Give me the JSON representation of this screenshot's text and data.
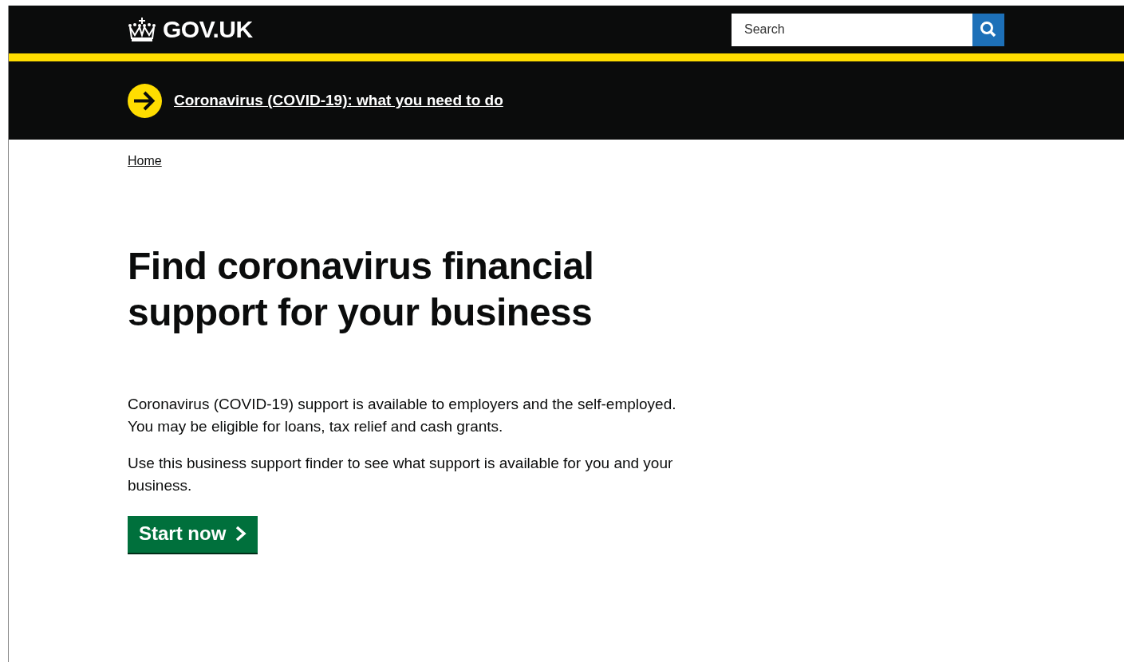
{
  "header": {
    "logo": "GOV.UK",
    "search": {
      "placeholder": "Search"
    }
  },
  "banner": {
    "link": "Coronavirus (COVID-19): what you need to do"
  },
  "breadcrumbs": [
    {
      "label": "Home"
    }
  ],
  "title": "Find coronavirus financial support for your business",
  "paragraphs": [
    "Coronavirus (COVID-19) support is available to employers and the self-employed. You may be eligible for loans, tax relief and cash grants.",
    "Use this business support finder to see what support is available for you and your business."
  ],
  "start_button": "Start now"
}
